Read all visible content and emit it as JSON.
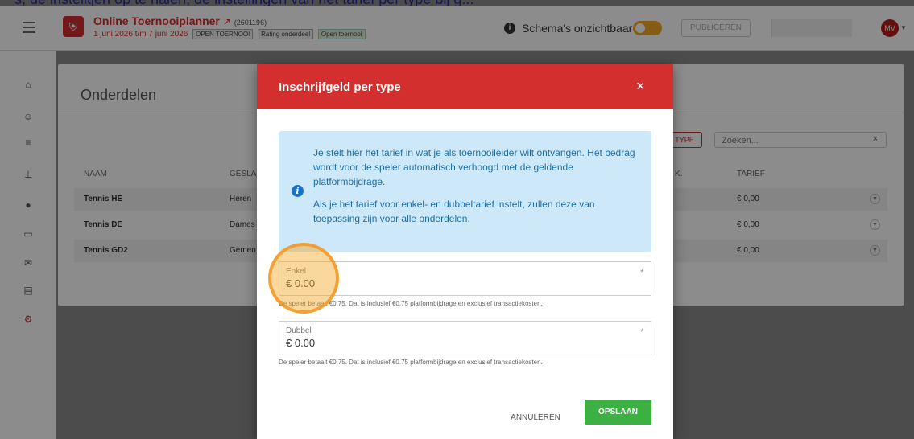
{
  "caption": {
    "text": "s, de instelltjen op te halen, de instellingen van het tarief per type bij g..."
  },
  "header": {
    "title": "Online Toernooiplanner",
    "external_icon": "external-link-icon",
    "tournament_id": "(2601196)",
    "dates": "1 juni 2026 t/m 7 juni 2026",
    "tags": [
      "OPEN TOERNOOI",
      "Rating onderdeel",
      "Open toernooi"
    ],
    "schema_label": "Schema's onzichtbaar",
    "publish_label": "PUBLICEREN",
    "avatar_initials": "MV"
  },
  "sidebar": {
    "icons": [
      "home-icon",
      "users-icon",
      "list-icon",
      "sitemap-icon",
      "tennis-ball-icon",
      "monitor-icon",
      "mail-icon",
      "documents-icon",
      "gear-icon"
    ],
    "active": "gear-icon"
  },
  "page": {
    "title": "Onderdelen",
    "type_button": "TYPE",
    "search_placeholder": "Zoeken...",
    "columns": [
      "NAAM",
      "GESLAC",
      "K.",
      "TARIEF"
    ],
    "rows": [
      {
        "name": "Tennis HE",
        "gender": "Heren",
        "fee": "€ 0,00"
      },
      {
        "name": "Tennis DE",
        "gender": "Dames",
        "fee": "€ 0,00"
      },
      {
        "name": "Tennis GD2",
        "gender": "Gemen",
        "fee": "€ 0,00"
      }
    ]
  },
  "modal": {
    "title": "Inschrijfgeld per type",
    "close": "×",
    "info_p1": "Je stelt hier het tarief in wat je als toernooileider wilt ontvangen. Het bedrag wordt voor de speler automatisch verhoogd met de geldende platformbijdrage.",
    "info_p2": "Als je het tarief voor enkel- en dubbeltarief instelt, zullen deze van toepassing zijn voor alle onderdelen.",
    "enkel": {
      "label": "Enkel",
      "value": "€ 0.00",
      "required": "*",
      "hint": "De speler betaalt €0.75. Dat is inclusief €0.75 platformbijdrage en exclusief transactiekosten."
    },
    "dubbel": {
      "label": "Dubbel",
      "value": "€ 0.00",
      "required": "*",
      "hint": "De speler betaalt €0.75. Dat is inclusief €0.75 platformbijdrage en exclusief transactiekosten."
    },
    "cancel_label": "ANNULEREN",
    "save_label": "OPSLAAN"
  },
  "colors": {
    "brand": "#d32f2f",
    "save": "#3cb043",
    "info_bg": "#cde8f8",
    "highlight": "#f5a623"
  }
}
